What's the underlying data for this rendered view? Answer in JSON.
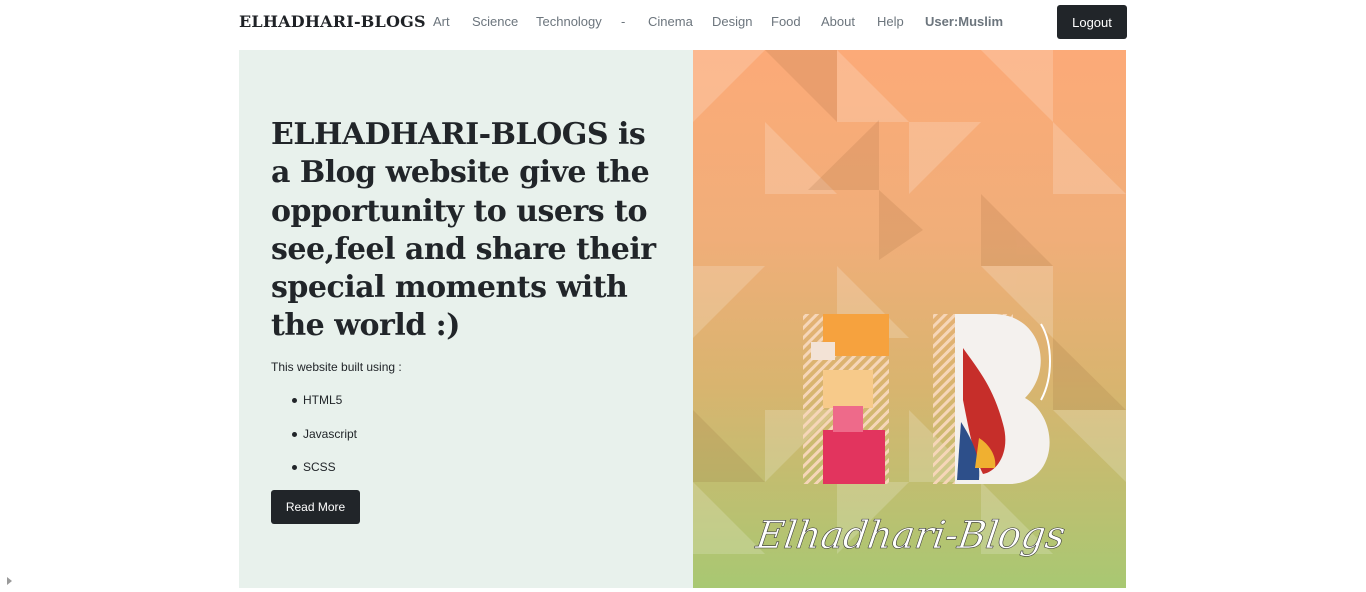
{
  "nav": {
    "brand": "ELHADHARI-BLOGS",
    "links": [
      "Art",
      "Science",
      "Technology",
      "-",
      "Cinema",
      "Design",
      "Food",
      "About",
      "Help"
    ],
    "user": "User:Muslim",
    "logout_label": "Logout"
  },
  "hero": {
    "title": "ELHADHARI-BLOGS is a Blog website give the opportunity to users to see,feel and share their special moments with the world :)",
    "built_label": "This website built using :",
    "tech": [
      "HTML5",
      "Javascript",
      "SCSS"
    ],
    "read_more_label": "Read More"
  },
  "banner": {
    "logo_text": "Elhadhari-Blogs",
    "monogram": "EB"
  },
  "colors": {
    "dark": "#212529",
    "hero_bg": "#e8f1ec",
    "banner_top": "#fcaa78",
    "banner_bottom": "#a8c872"
  }
}
